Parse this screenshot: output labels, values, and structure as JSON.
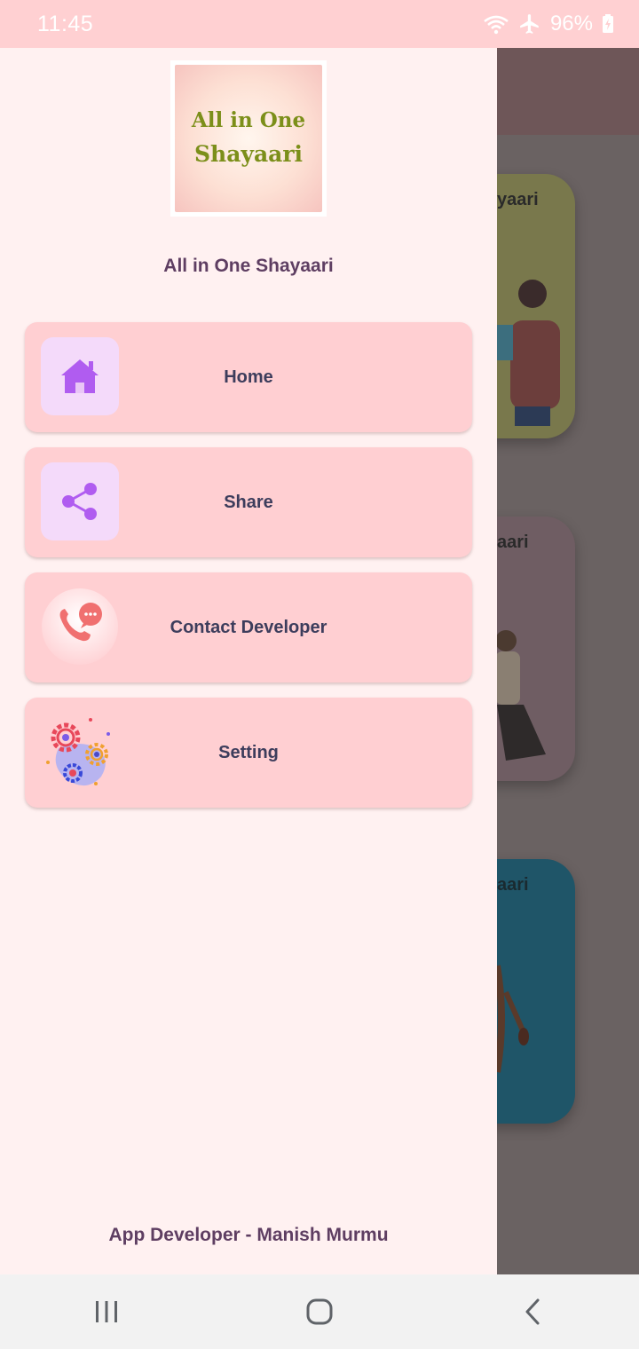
{
  "status_bar": {
    "time": "11:45",
    "battery": "96%",
    "icons": [
      "wifi-icon",
      "airplane-mode-icon",
      "battery-charging-icon"
    ]
  },
  "background": {
    "cards": [
      {
        "title": "yaari"
      },
      {
        "title": "aari"
      },
      {
        "title": "aari"
      }
    ]
  },
  "drawer": {
    "logo": {
      "line1": "All in One",
      "line2": "Shayaari"
    },
    "app_title": "All in One Shayaari",
    "menu": [
      {
        "label": "Home",
        "icon": "home-icon"
      },
      {
        "label": "Share",
        "icon": "share-icon"
      },
      {
        "label": "Contact Developer",
        "icon": "phone-chat-icon"
      },
      {
        "label": "Setting",
        "icon": "gears-icon"
      }
    ],
    "footer": "App Developer - Manish Murmu"
  },
  "nav_bar": {
    "buttons": [
      "recent-apps-icon",
      "home-button-icon",
      "back-icon"
    ]
  },
  "colors": {
    "status_bar": "#ffd0d2",
    "drawer_bg": "#fff1f1",
    "menu_item_bg": "#ffcfd2",
    "icon_box_bg": "#f4dafa",
    "accent_purple": "#b05cf0",
    "title_text": "#5e3e62",
    "label_text": "#3d3d5c"
  }
}
